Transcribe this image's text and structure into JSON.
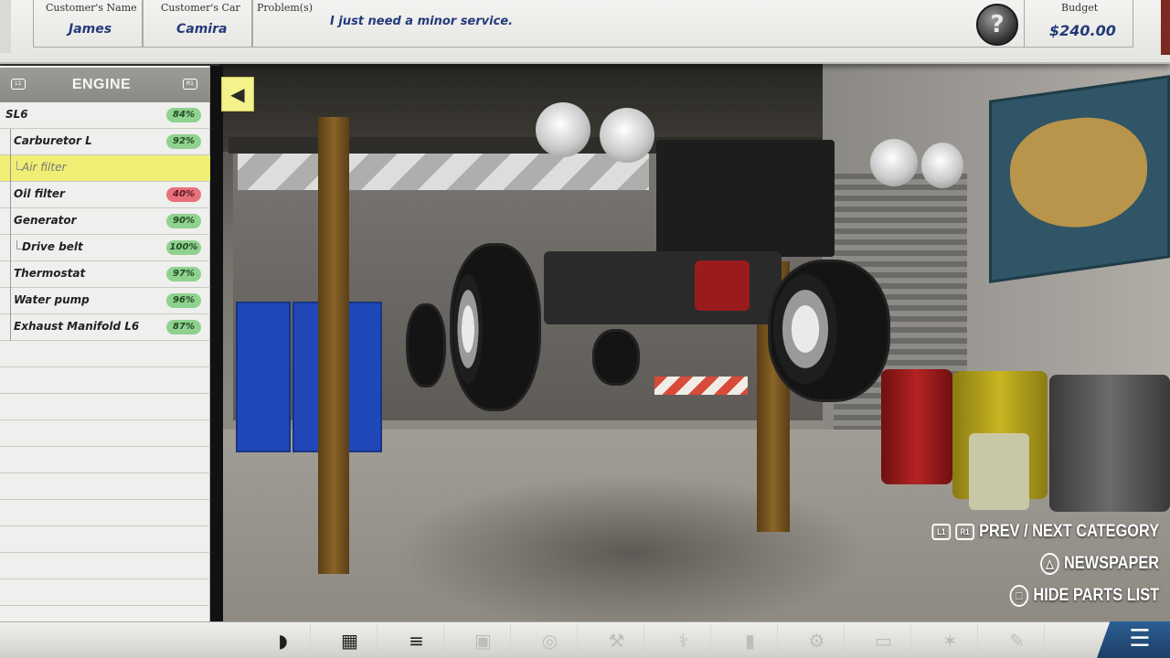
{
  "customer": {
    "name_label": "Customer's Name",
    "name": "James",
    "car_label": "Customer's Car",
    "car": "Camira",
    "problem_label": "Problem(s)",
    "problem": "I just need a minor service.",
    "help_icon": "question-mark-icon",
    "budget_label": "Budget",
    "budget": "$240.00"
  },
  "parts_list": {
    "category": "ENGINE",
    "prev_chip": "L1",
    "next_chip": "R1",
    "collapse_icon": "triangle-left-icon",
    "items": [
      {
        "name": "SL6",
        "pct": "84%",
        "pct_value": 84,
        "color": "#8fd18f"
      },
      {
        "name": "Carburetor L",
        "pct": "92%",
        "pct_value": 92,
        "color": "#8fd18f"
      },
      {
        "name": "Air filter",
        "pct": "",
        "pct_value": null,
        "color": "",
        "selected": true
      },
      {
        "name": "Oil filter",
        "pct": "40%",
        "pct_value": 40,
        "color": "#e8707b"
      },
      {
        "name": "Generator",
        "pct": "90%",
        "pct_value": 90,
        "color": "#8fd18f"
      },
      {
        "name": "Drive belt",
        "pct": "100%",
        "pct_value": 100,
        "color": "#8fd18f"
      },
      {
        "name": "Thermostat",
        "pct": "97%",
        "pct_value": 97,
        "color": "#8fd18f"
      },
      {
        "name": "Water pump",
        "pct": "96%",
        "pct_value": 96,
        "color": "#8fd18f"
      },
      {
        "name": "Exhaust Manifold L6",
        "pct": "87%",
        "pct_value": 87,
        "color": "#8fd18f"
      }
    ]
  },
  "hints": {
    "prev_next": "PREV / NEXT CATEGORY",
    "l1": "L1",
    "r1": "R1",
    "newspaper": "NEWSPAPER",
    "hide_parts": "HIDE PARTS LIST",
    "triangle_icon": "triangle-button-icon",
    "square_icon": "square-button-icon"
  },
  "toolbar": {
    "tools": [
      {
        "icon": "headlight-icon",
        "enabled": true
      },
      {
        "icon": "car-manual-icon",
        "enabled": true
      },
      {
        "icon": "parts-order-icon",
        "enabled": true
      },
      {
        "icon": "jerry-can-icon",
        "enabled": false
      },
      {
        "icon": "tire-icon",
        "enabled": false
      },
      {
        "icon": "tool-icon",
        "enabled": false
      },
      {
        "icon": "thermometer-icon",
        "enabled": false
      },
      {
        "icon": "oil-can-icon",
        "enabled": false
      },
      {
        "icon": "wrench-icon",
        "enabled": false
      },
      {
        "icon": "battery-icon",
        "enabled": false
      },
      {
        "icon": "spray-icon",
        "enabled": false
      },
      {
        "icon": "paint-icon",
        "enabled": false
      }
    ],
    "menu_icon": "hamburger-menu-icon"
  }
}
